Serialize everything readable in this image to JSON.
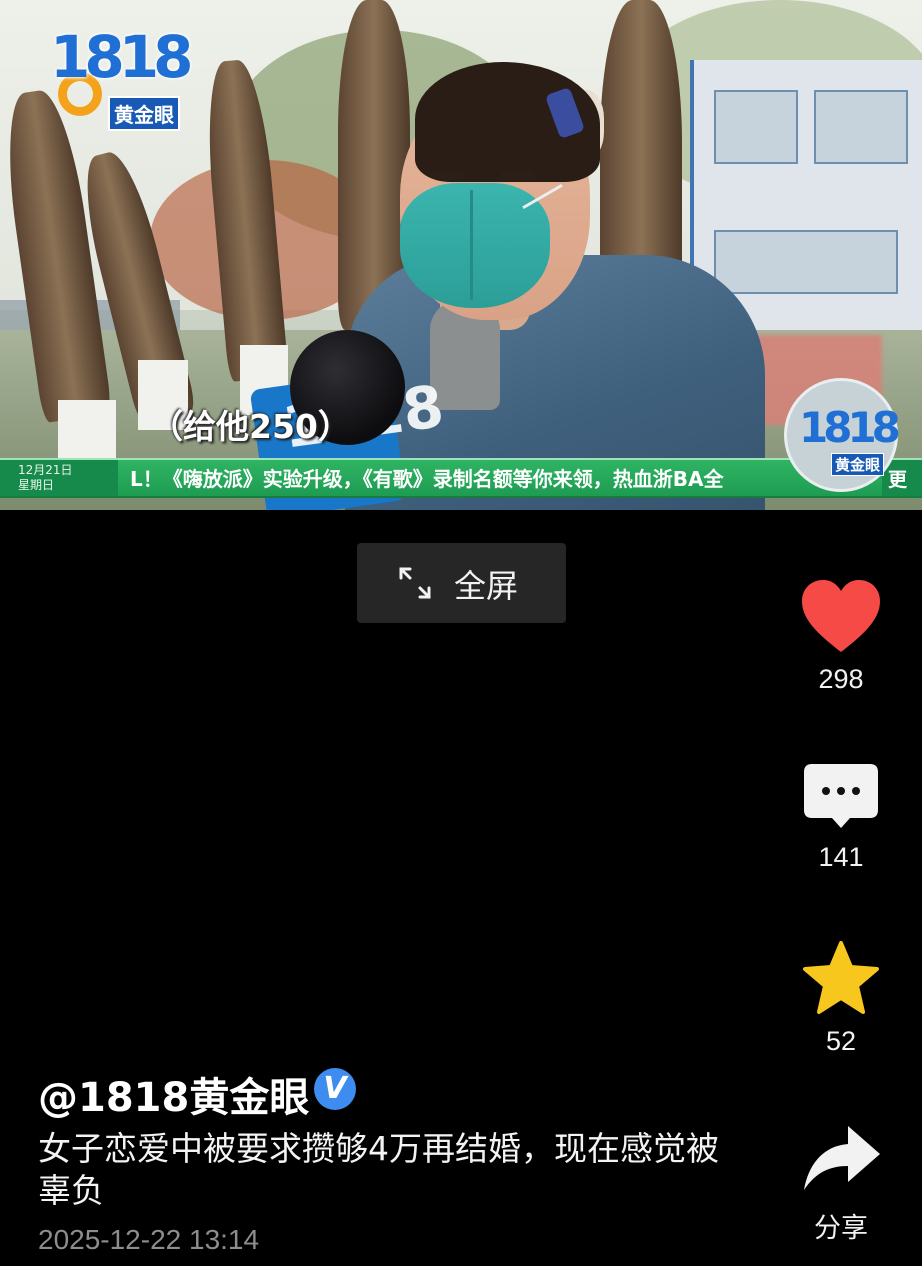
{
  "video": {
    "logo_number": "1818",
    "logo_text": "黄金眼",
    "subtitle": "（给他250）",
    "ticker_date_line1": "12月21日",
    "ticker_date_line2": "星期日",
    "ticker_text": "L！《嗨放派》实验升级，《有歌》录制名额等你来领，热血浙BA全",
    "ticker_tail": "更"
  },
  "controls": {
    "fullscreen_label": "全屏"
  },
  "actions": {
    "like_count": "298",
    "comment_count": "141",
    "favorite_count": "52",
    "share_label": "分享",
    "like_color": "#f54a45",
    "favorite_color": "#f7c71d"
  },
  "post": {
    "author": "@1818黄金眼",
    "verified_mark": "V",
    "caption": "女子恋爱中被要求攒够4万再结婚，现在感觉被辜负",
    "date": "2025-12-22 13:14"
  }
}
